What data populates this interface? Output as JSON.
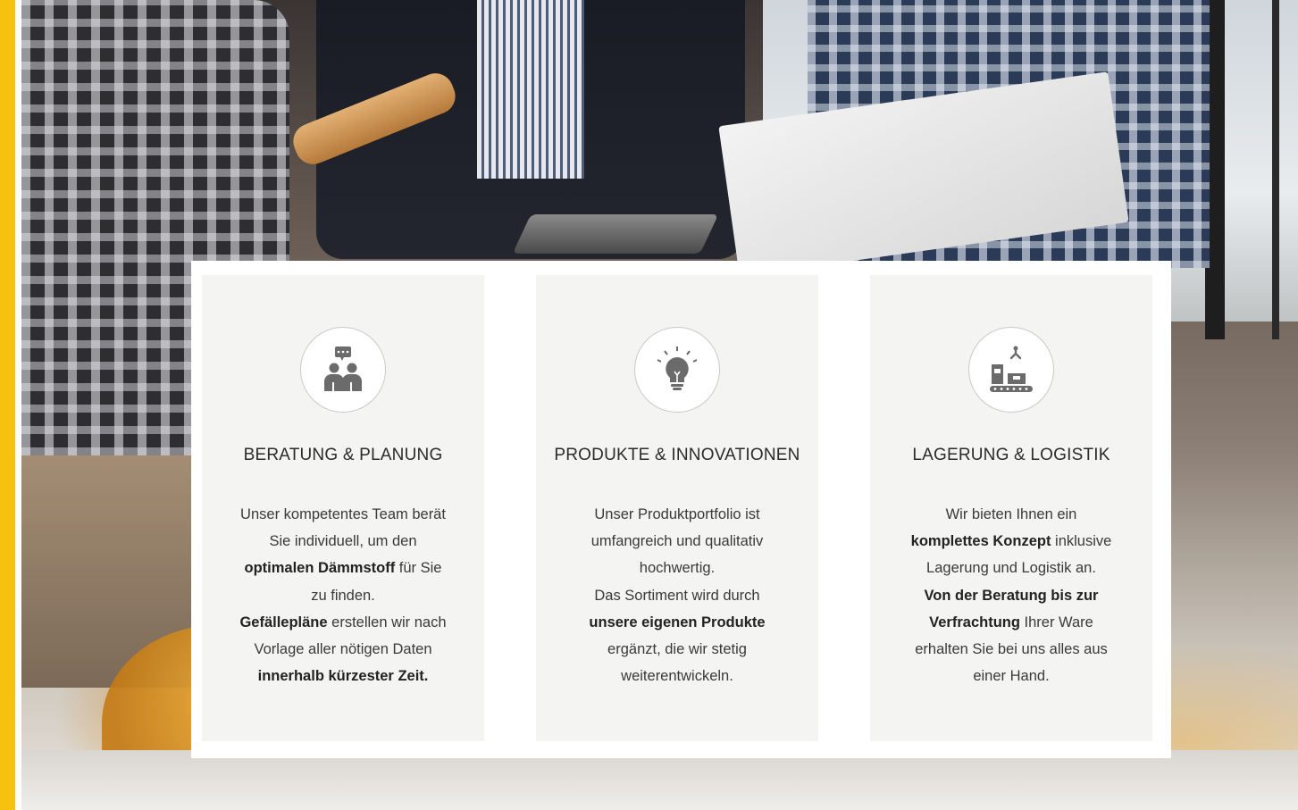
{
  "cards": [
    {
      "icon": "team-consulting-icon",
      "title": "BERATUNG & PLANUNG",
      "lines": [
        [
          {
            "t": "Unser kompetentes Team berät",
            "b": false
          }
        ],
        [
          {
            "t": "Sie individuell, um den",
            "b": false
          }
        ],
        [
          {
            "t": "optimalen Dämmstoff",
            "b": true
          },
          {
            "t": " für Sie",
            "b": false
          }
        ],
        [
          {
            "t": "zu finden.",
            "b": false
          }
        ],
        [
          {
            "t": "Gefällepläne",
            "b": true
          },
          {
            "t": " erstellen wir nach",
            "b": false
          }
        ],
        [
          {
            "t": "Vorlage aller nötigen Daten",
            "b": false
          }
        ],
        [
          {
            "t": "innerhalb kürzester Zeit.",
            "b": true
          }
        ]
      ]
    },
    {
      "icon": "lightbulb-icon",
      "title": "PRODUKTE & INNOVATIONEN",
      "lines": [
        [
          {
            "t": "Unser Produktportfolio ist",
            "b": false
          }
        ],
        [
          {
            "t": "umfangreich und qualitativ",
            "b": false
          }
        ],
        [
          {
            "t": "hochwertig.",
            "b": false
          }
        ],
        [
          {
            "t": "Das Sortiment wird durch",
            "b": false
          }
        ],
        [
          {
            "t": "unsere eigenen Produkte",
            "b": true
          }
        ],
        [
          {
            "t": "ergänzt, die wir stetig",
            "b": false
          }
        ],
        [
          {
            "t": "weiterentwickeln.",
            "b": false
          }
        ]
      ]
    },
    {
      "icon": "conveyor-logistics-icon",
      "title": "LAGERUNG & LOGISTIK",
      "lines": [
        [
          {
            "t": "Wir bieten Ihnen ein",
            "b": false
          }
        ],
        [
          {
            "t": "komplettes Konzept",
            "b": true
          },
          {
            "t": " inklusive",
            "b": false
          }
        ],
        [
          {
            "t": "Lagerung und Logistik an.",
            "b": false
          }
        ],
        [
          {
            "t": "Von der Beratung bis zur",
            "b": true
          }
        ],
        [
          {
            "t": "Verfrachtung",
            "b": true
          },
          {
            "t": " Ihrer Ware",
            "b": false
          }
        ],
        [
          {
            "t": "erhalten Sie bei uns alles aus",
            "b": false
          }
        ],
        [
          {
            "t": "einer Hand.",
            "b": false
          }
        ]
      ]
    }
  ],
  "colors": {
    "accent": "#f7c20f",
    "card_bg": "#f4f4f3",
    "icon_gray": "#6b6b6b"
  }
}
